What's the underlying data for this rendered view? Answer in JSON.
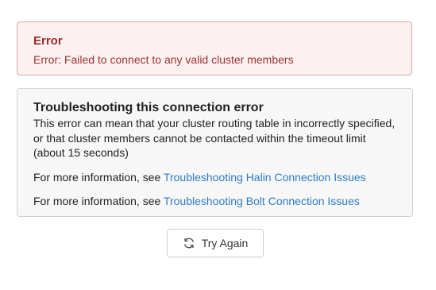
{
  "error": {
    "title": "Error",
    "message": "Error: Failed to connect to any valid cluster members"
  },
  "troubleshooting": {
    "title": "Troubleshooting this connection error",
    "description": "This error can mean that your cluster routing table in incorrectly specified, or that cluster members cannot be contacted within the timeout limit (about 15 seconds)",
    "links": [
      {
        "prefix": "For more information, see ",
        "label": "Troubleshooting Halin Connection Issues"
      },
      {
        "prefix": "For more information, see ",
        "label": "Troubleshooting Bolt Connection Issues"
      }
    ]
  },
  "actions": {
    "try_again_label": "Try Again",
    "try_again_icon": "refresh-icon"
  },
  "colors": {
    "error_text": "#9b2b2b",
    "error_bg": "#fcf0f0",
    "error_border": "#dba8a8",
    "link": "#2f7bc2"
  }
}
